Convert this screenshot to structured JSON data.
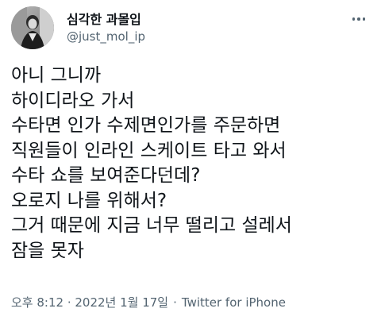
{
  "author": {
    "display_name": "심각한 과몰입",
    "handle": "@just_mol_ip"
  },
  "tweet": {
    "lines": [
      "아니 그니까",
      "하이디라오 가서",
      "수타면 인가 수제면인가를 주문하면",
      "직원들이 인라인 스케이트 타고 와서",
      "수타 쇼를 보여준다던데?",
      "오로지 나를 위해서?",
      "그거 때문에 지금 너무 떨리고 설레서",
      "잠을 못자"
    ],
    "timestamp": "오후 8:12 · 2022년 1월 17일",
    "separator": "·",
    "source": "Twitter for iPhone"
  },
  "icons": {
    "more": "more-horizontal-icon"
  },
  "colors": {
    "text": "#0f1419",
    "secondary": "#536471",
    "background": "#ffffff"
  }
}
